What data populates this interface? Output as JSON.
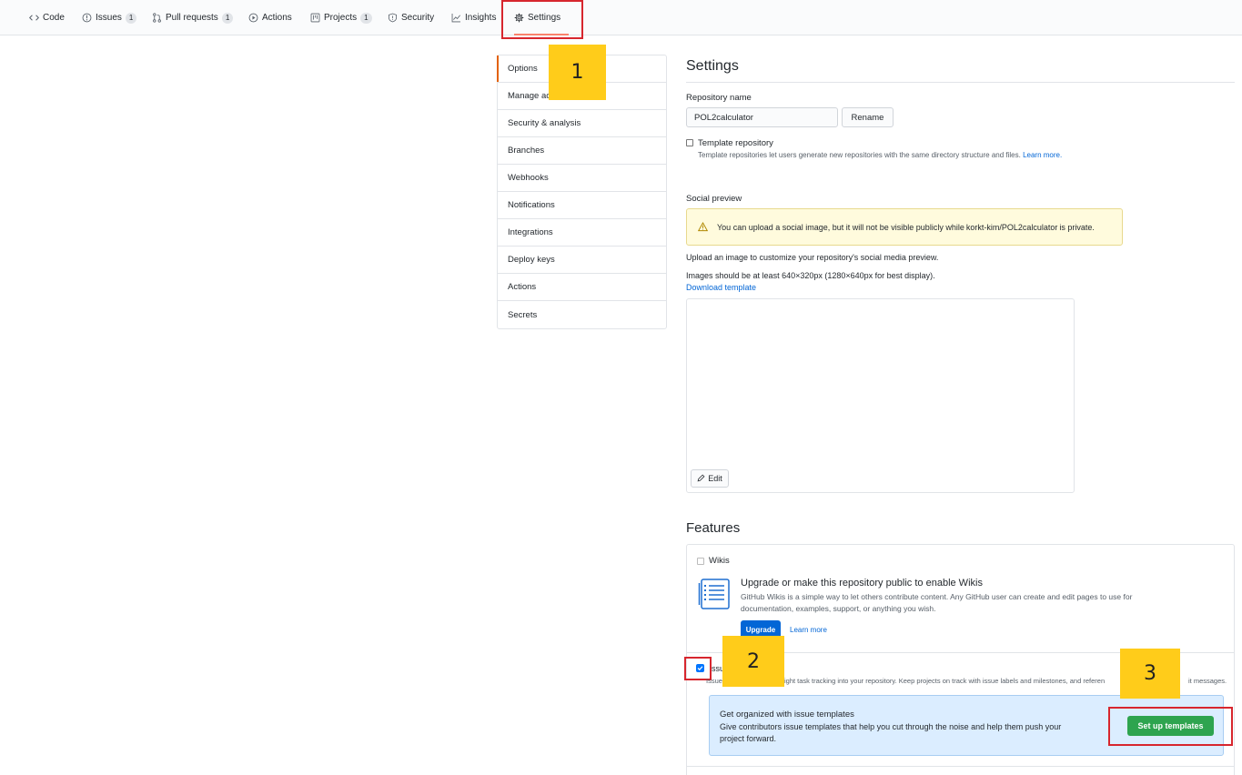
{
  "tabs": [
    {
      "label": "Code",
      "icon": "code-icon",
      "count": null
    },
    {
      "label": "Issues",
      "icon": "issue-icon",
      "count": "1"
    },
    {
      "label": "Pull requests",
      "icon": "pull-request-icon",
      "count": "1"
    },
    {
      "label": "Actions",
      "icon": "play-icon",
      "count": null
    },
    {
      "label": "Projects",
      "icon": "project-icon",
      "count": "1"
    },
    {
      "label": "Security",
      "icon": "shield-icon",
      "count": null
    },
    {
      "label": "Insights",
      "icon": "graph-icon",
      "count": null
    },
    {
      "label": "Settings",
      "icon": "gear-icon",
      "count": null,
      "selected": true
    }
  ],
  "markers": {
    "one": "1",
    "two": "2",
    "three": "3"
  },
  "menu": {
    "items": [
      "Options",
      "Manage access",
      "Security & analysis",
      "Branches",
      "Webhooks",
      "Notifications",
      "Integrations",
      "Deploy keys",
      "Actions",
      "Secrets"
    ],
    "selected": "Options"
  },
  "settings": {
    "title": "Settings",
    "repo_name_label": "Repository name",
    "repo_name_value": "POL2calculator",
    "rename_button": "Rename",
    "template_label": "Template repository",
    "template_note": "Template repositories let users generate new repositories with the same directory structure and files.",
    "learn_more": "Learn more.",
    "social_preview_label": "Social preview",
    "flash_text_pre": "You can upload a social image, but it will not be visible publicly while ",
    "flash_repo": "korkt-kim/POL2calculator",
    "flash_text_post": " is private.",
    "upload_text": "Upload an image to customize your repository's social media preview.",
    "size_text": "Images should be at least 640×320px (1280×640px for best display).",
    "download_template": "Download template",
    "edit_button": "Edit"
  },
  "features": {
    "title": "Features",
    "wikis_label": "Wikis",
    "wikis_checked": false,
    "upgrade_heading": "Upgrade or make this repository public to enable Wikis",
    "upgrade_desc_1": "GitHub Wikis is a simple way to let others contribute content. Any GitHub user can create and edit pages to use for",
    "upgrade_desc_2": "documentation, examples, support, or anything you wish.",
    "upgrade_button": "Upgrade",
    "upgrade_learn_more": "Learn more",
    "issues_label_visible": "ssu",
    "issues_checked": true,
    "issues_desc_prefix": "Issue",
    "issues_desc_mid": "ight task tracking into your repository. Keep projects on track with issue labels and milestones, and referen",
    "issues_desc_suffix": "it messages.",
    "templates_heading": "Get organized with issue templates",
    "templates_desc_1": "Give contributors issue templates that help you cut through the noise and help them push your",
    "templates_desc_2": "project forward.",
    "setup_button": "Set up templates"
  },
  "colors": {
    "accent_tab": "#f9826c",
    "callout": "#d7262e",
    "marker": "#ffcc1a",
    "link": "#0366d6",
    "primary_button": "#0366d6",
    "green_button": "#2ea44f"
  }
}
